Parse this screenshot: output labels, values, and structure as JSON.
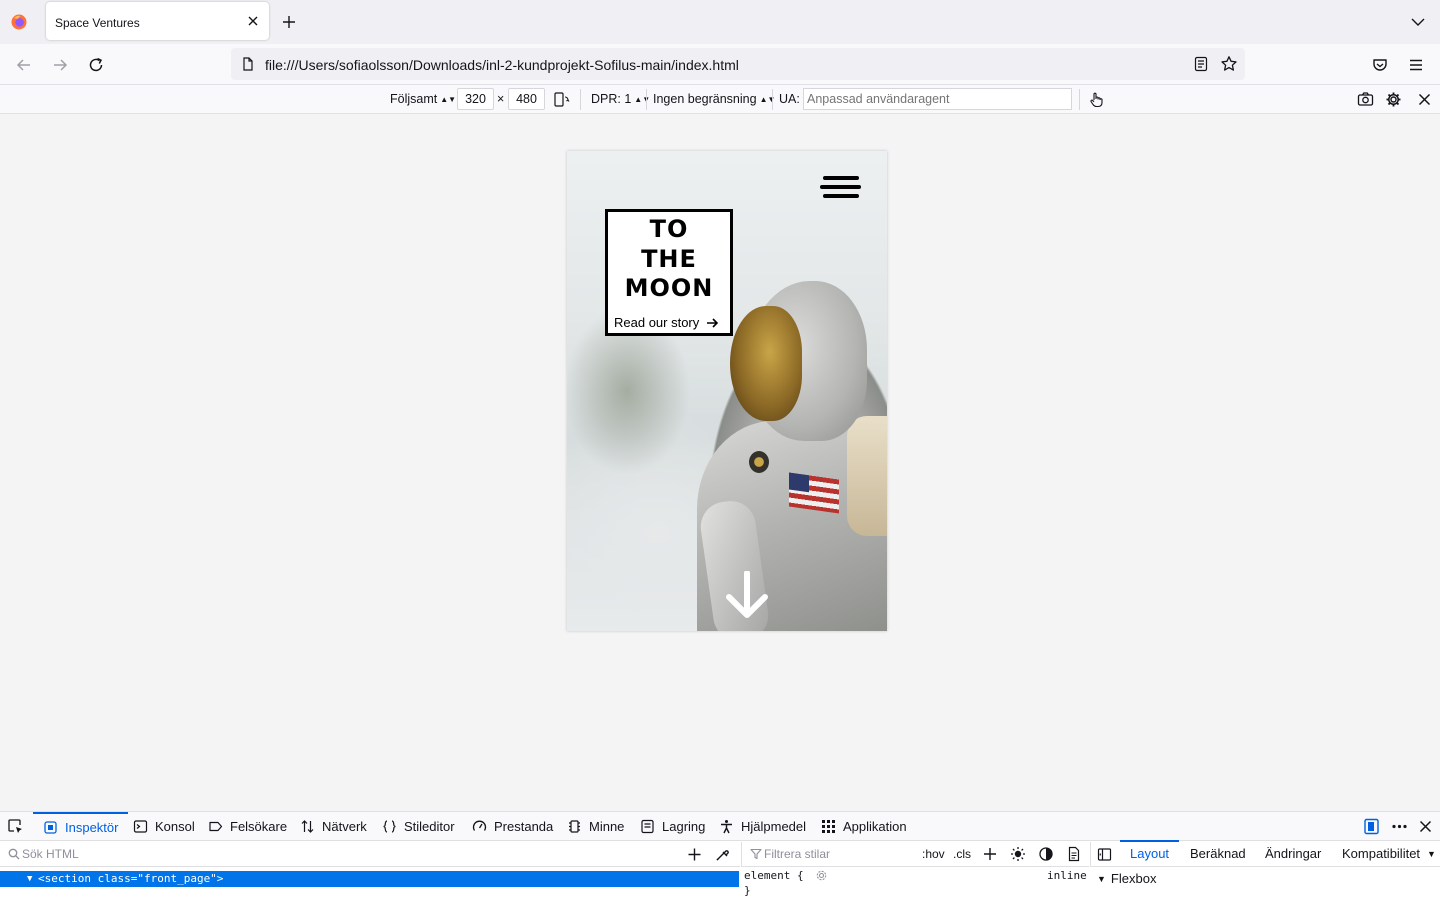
{
  "browser": {
    "tab": {
      "title": "Space Ventures"
    },
    "url": "file:///Users/sofiaolsson/Downloads/inl-2-kundprojekt-Sofilus-main/index.html"
  },
  "rdm": {
    "device": "Följsamt",
    "width": "320",
    "times": "×",
    "height": "480",
    "dpr": "DPR: 1",
    "throttling": "Ingen begränsning",
    "ua_label": "UA:",
    "ua_placeholder": "Anpassad användaragent"
  },
  "page": {
    "title_lines": [
      "TO",
      "THE",
      "MOON"
    ],
    "link_text": "Read our story"
  },
  "devtools": {
    "tabs": [
      "Inspektör",
      "Konsol",
      "Felsökare",
      "Nätverk",
      "Stileditor",
      "Prestanda",
      "Minne",
      "Lagring",
      "Hjälpmedel",
      "Applikation"
    ],
    "search_placeholder": "Sök HTML",
    "styles_placeholder": "Filtrera stilar",
    "hov": ":hov",
    "cls": ".cls",
    "layout_tabs": [
      "Layout",
      "Beräknad",
      "Ändringar",
      "Kompatibilitet"
    ],
    "selected_node": "<section class=\"front_page\">",
    "rule_selector": "element {",
    "rule_close": "}",
    "rule_source": "inline",
    "flexbox_label": "Flexbox"
  }
}
